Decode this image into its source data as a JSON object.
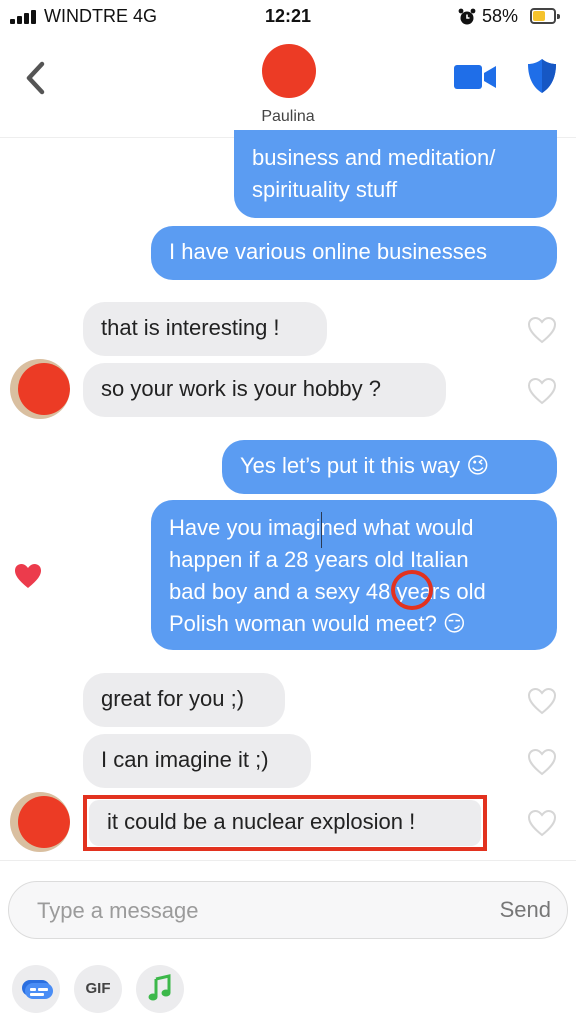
{
  "status_bar": {
    "carrier": "WINDTRE  4G",
    "time": "12:21",
    "battery": "58%",
    "battery_level": 0.58
  },
  "header": {
    "contact_name": "Paulina",
    "icons": [
      "back-chevron-icon",
      "video-call-icon",
      "safety-shield-icon"
    ],
    "accent": "#1f6ee8"
  },
  "messages": [
    {
      "side": "out",
      "text": "business and meditation/\nspirituality stuff"
    },
    {
      "side": "out",
      "text": "I have various online businesses"
    },
    {
      "side": "in",
      "text": "that is interesting !"
    },
    {
      "side": "in",
      "text": "so your work is your hobby ?"
    },
    {
      "side": "out",
      "text": "Yes let’s put it this way 😉"
    },
    {
      "side": "out",
      "text": "Have you imagined what would\nhappen if a 28 years old Italian\nbad boy and a sexy 48 years old\nPolish woman would meet? 😏",
      "liked": true
    },
    {
      "side": "in",
      "text": "great for you ;)"
    },
    {
      "side": "in",
      "text": "I can imagine it ;)"
    },
    {
      "side": "in",
      "text": "it could be a nuclear explosion !",
      "highlighted": true
    }
  ],
  "composer": {
    "placeholder": "Type a message",
    "send_label": "Send",
    "tools": [
      "emoji-keyboard-icon",
      "GIF",
      "music-note-icon"
    ]
  },
  "colors": {
    "outgoing_bubble": "#5b9cf2",
    "incoming_bubble": "#ececee",
    "annotation_red": "#e2321f",
    "like_heart": "#ec3b4c"
  }
}
